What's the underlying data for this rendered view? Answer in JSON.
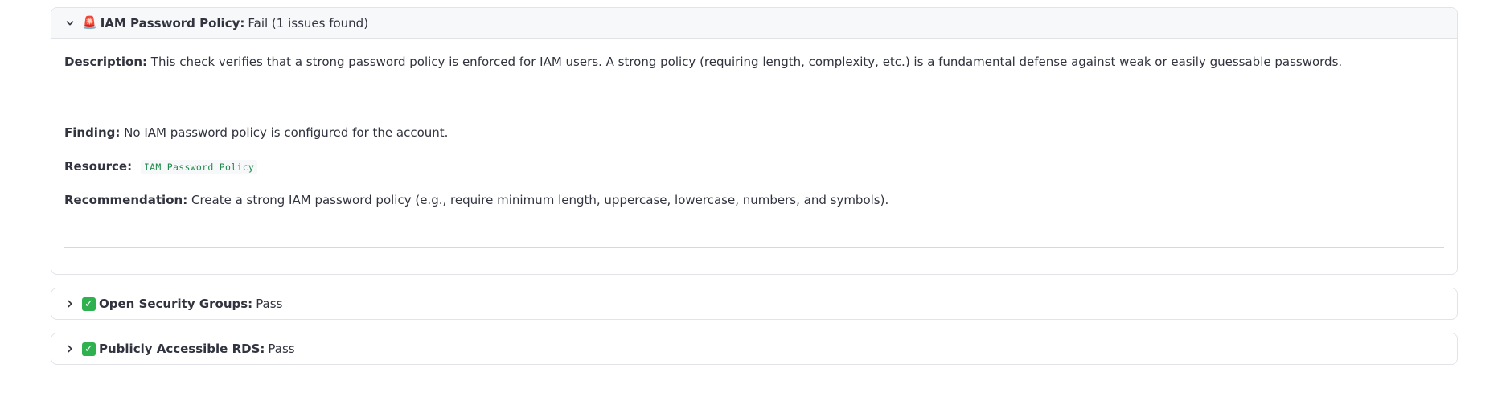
{
  "checks": [
    {
      "expanded": true,
      "status_emoji": "🚨",
      "title": "IAM Password Policy:",
      "status_text": "Fail (1 issues found)",
      "description_label": "Description:",
      "description": "This check verifies that a strong password policy is enforced for IAM users. A strong policy (requiring length, complexity, etc.) is a fundamental defense against weak or easily guessable passwords.",
      "finding_label": "Finding:",
      "finding": "No IAM password policy is configured for the account.",
      "resource_label": "Resource:",
      "resource": "IAM Password Policy",
      "recommendation_label": "Recommendation:",
      "recommendation": "Create a strong IAM password policy (e.g., require minimum length, uppercase, lowercase, numbers, and symbols)."
    },
    {
      "expanded": false,
      "status_emoji": "✅",
      "title": "Open Security Groups:",
      "status_text": "Pass"
    },
    {
      "expanded": false,
      "status_emoji": "✅",
      "title": "Publicly Accessible RDS:",
      "status_text": "Pass"
    }
  ],
  "icons": {
    "expanded_chevron": "chevron-down-icon",
    "collapsed_chevron": "chevron-right-icon",
    "fail_icon": "alert-siren-icon",
    "pass_icon": "check-mark-icon"
  },
  "colors": {
    "code_text": "#1f8a4c",
    "pass_green": "#2fb14f",
    "border": "#e1e3e8"
  }
}
